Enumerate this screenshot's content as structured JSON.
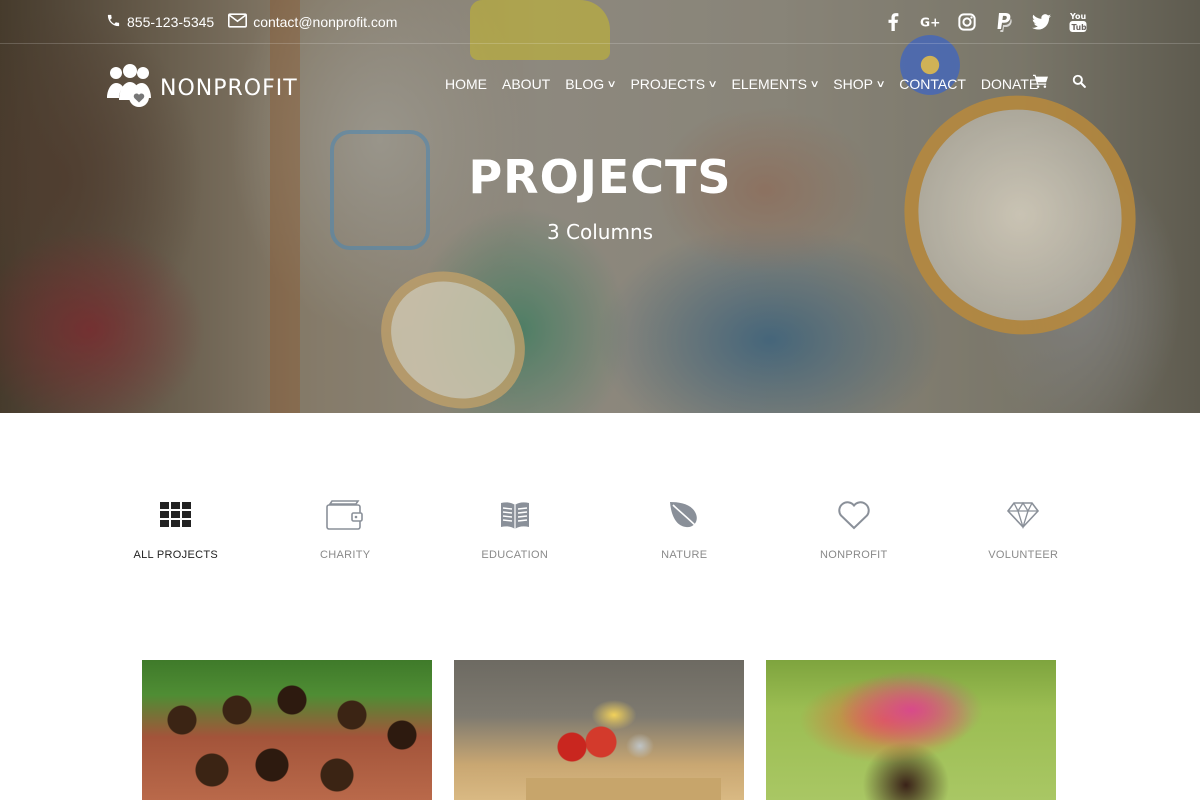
{
  "topbar": {
    "phone": "855-123-5345",
    "email": "contact@nonprofit.com",
    "social": [
      {
        "icon": "facebook-icon"
      },
      {
        "icon": "google-plus-icon"
      },
      {
        "icon": "instagram-icon"
      },
      {
        "icon": "paypal-icon"
      },
      {
        "icon": "twitter-icon"
      },
      {
        "icon": "youtube-icon"
      }
    ]
  },
  "header": {
    "logo_text": "NONPROFIT",
    "nav": [
      "HOME",
      "ABOUT",
      "BLOG",
      "PROJECTS",
      "ELEMENTS",
      "SHOP",
      "CONTACT",
      "DONATE"
    ],
    "nav_has_dropdown": [
      false,
      false,
      true,
      true,
      true,
      true,
      false,
      false
    ],
    "icons": [
      "cart-icon",
      "search-icon"
    ]
  },
  "hero": {
    "title": "PROJECTS",
    "subtitle": "3 Columns"
  },
  "filters": [
    {
      "label": "ALL PROJECTS",
      "icon": "grid-icon",
      "active": true
    },
    {
      "label": "CHARITY",
      "icon": "wallet-icon",
      "active": false
    },
    {
      "label": "EDUCATION",
      "icon": "book-icon",
      "active": false
    },
    {
      "label": "NATURE",
      "icon": "leaf-icon",
      "active": false
    },
    {
      "label": "NONPROFIT",
      "icon": "heart-icon",
      "active": false
    },
    {
      "label": "VOLUNTEER",
      "icon": "diamond-icon",
      "active": false
    }
  ],
  "cards": [
    {
      "image": "children-group-photo"
    },
    {
      "image": "food-donation-box-photo"
    },
    {
      "image": "woman-headscarf-photo"
    }
  ],
  "colors": {
    "overlay": "#000000",
    "text_on_hero": "#ffffff",
    "filter_icon": "#8a9099",
    "filter_icon_active": "#222222"
  }
}
